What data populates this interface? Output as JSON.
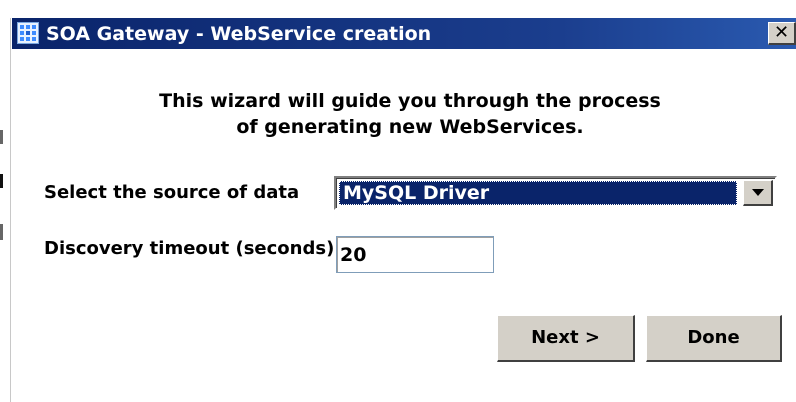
{
  "window": {
    "title": "SOA Gateway - WebService creation",
    "close_label": "✕",
    "app_icon": "grid-dots-icon",
    "colors": {
      "titlebar": "#0a246a",
      "face": "#d4d0c8",
      "selection": "#0a246a"
    }
  },
  "intro": {
    "line1": "This wizard will guide you through the process",
    "line2": "of generating new WebServices."
  },
  "form": {
    "source_label": "Select the source of data",
    "source_selected": "MySQL Driver",
    "timeout_label": "Discovery timeout (seconds)",
    "timeout_value": "20"
  },
  "buttons": {
    "next_label": "Next >",
    "done_label": "Done"
  }
}
